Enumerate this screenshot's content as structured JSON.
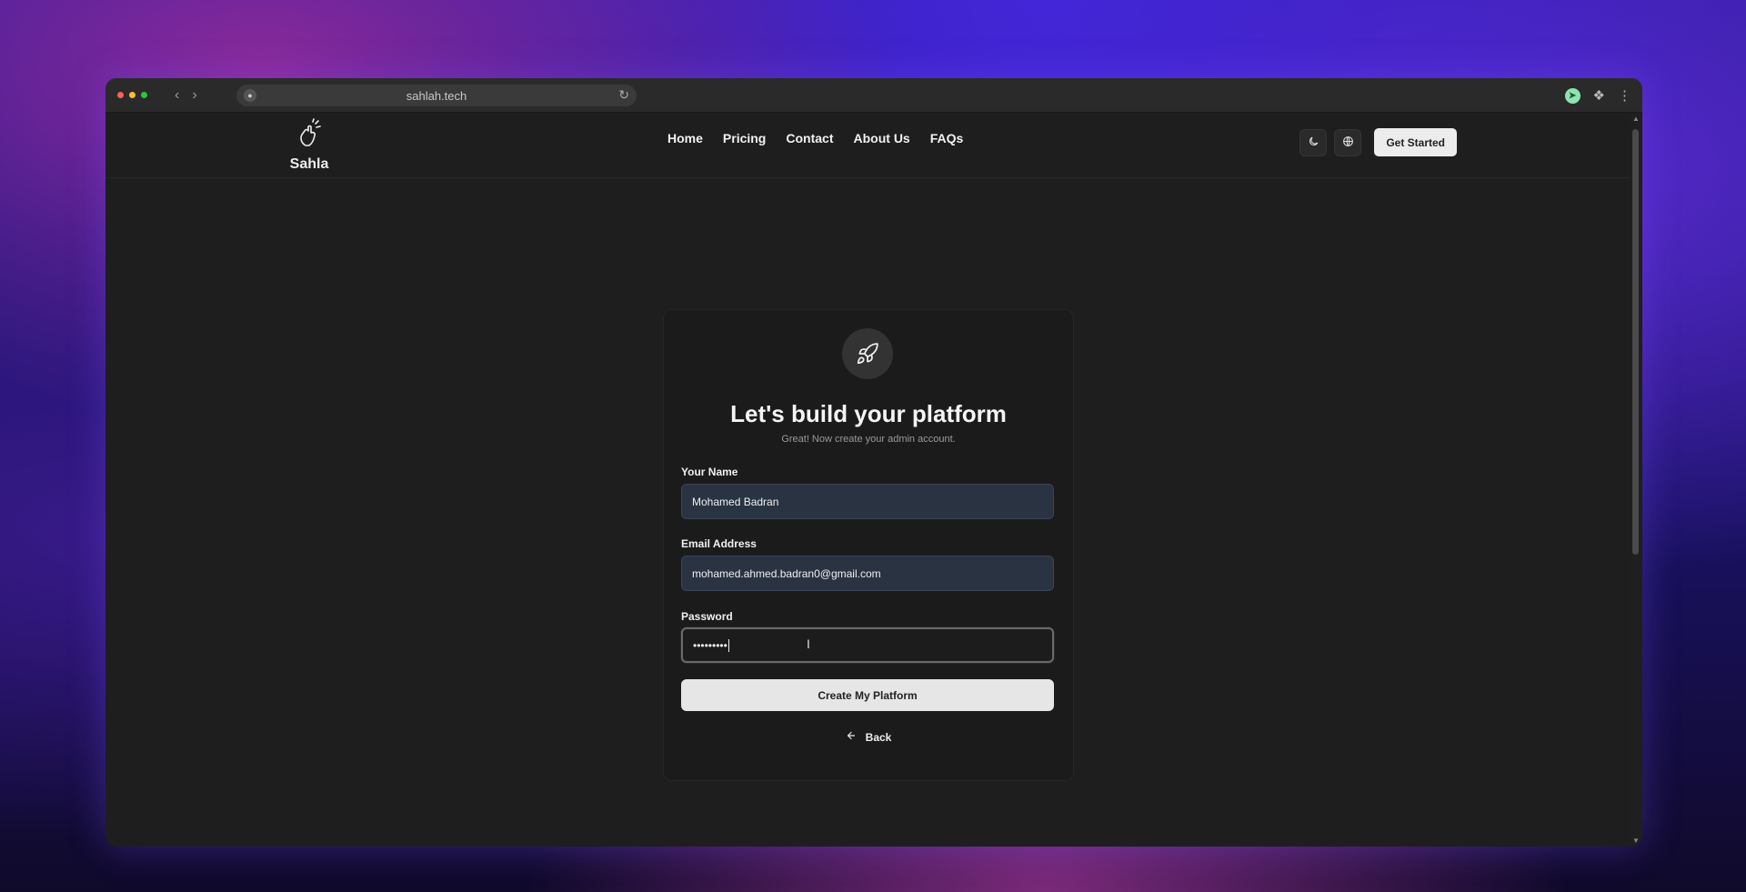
{
  "browser": {
    "url": "sahlah.tech"
  },
  "site": {
    "brand": "Sahla",
    "nav": [
      {
        "label": "Home"
      },
      {
        "label": "Pricing"
      },
      {
        "label": "Contact"
      },
      {
        "label": "About Us"
      },
      {
        "label": "FAQs"
      }
    ],
    "get_started": "Get Started"
  },
  "form": {
    "title": "Let's build your platform",
    "subtitle": "Great! Now create your admin account.",
    "name_label": "Your Name",
    "name_value": "Mohamed Badran",
    "email_label": "Email Address",
    "email_value": "mohamed.ahmed.badran0@gmail.com",
    "password_label": "Password",
    "password_value": "•••••••••",
    "submit": "Create My Platform",
    "back": "Back"
  },
  "icons": {
    "rocket": "rocket-icon",
    "theme": "moon-icon",
    "language": "globe-icon"
  }
}
